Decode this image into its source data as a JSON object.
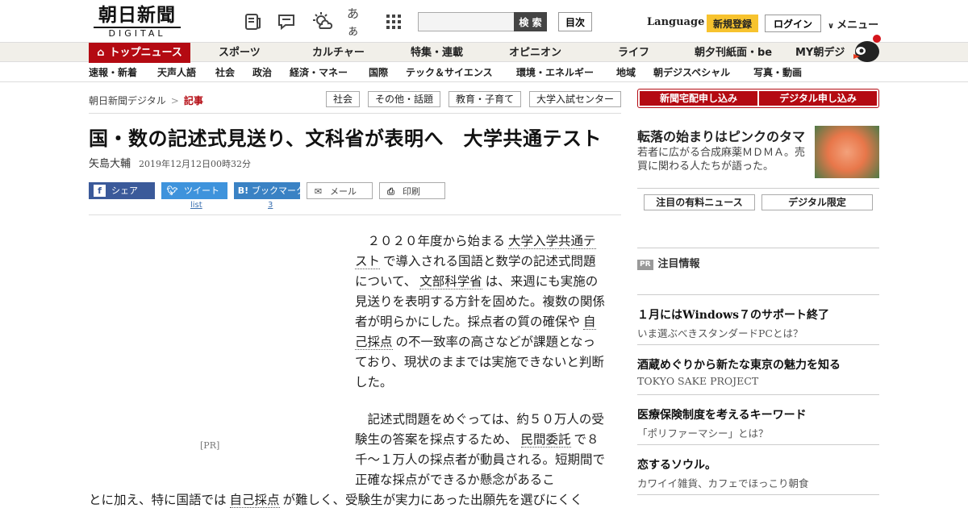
{
  "header": {
    "logo_main": "朝日新聞",
    "logo_sub": "DIGITAL",
    "text_size_icon_glyph": "あぁ",
    "search": {
      "placeholder": "",
      "button_label": "検 索"
    },
    "index_label": "目次",
    "language_label": "Language",
    "register_label": "新規登録",
    "login_label": "ログイン",
    "menu_label": "メニュー"
  },
  "main_nav": [
    "トップニュース",
    "スポーツ",
    "カルチャー",
    "特集・連載",
    "オピニオン",
    "ライフ",
    "朝夕刊紙面・be",
    "MY朝デジ"
  ],
  "sub_nav": [
    "速報・新着",
    "天声人語",
    "社会",
    "政治",
    "経済・マネー",
    "国際",
    "テック＆サイエンス",
    "環境・エネルギー",
    "地域",
    "朝デジスペシャル",
    "写真・動画"
  ],
  "breadcrumb": {
    "home": "朝日新聞デジタル",
    "separator": ">",
    "current": "記事"
  },
  "tags": [
    "社会",
    "その他・話題",
    "教育・子育て",
    "大学入試センター"
  ],
  "article": {
    "headline": "国・数の記述式見送り、文科省が表明へ　大学共通テスト",
    "author": "矢島大輔",
    "date": "2019年12月12日00時32分",
    "ad_label": "[PR]",
    "p1_a": "２０２０年度から始まる",
    "p1_kw1": "大学入学共通テスト",
    "p1_b": "で導入される国語と数学の記述式問題について、",
    "p1_kw2": "文部科学省",
    "p1_c": "は、来週にも実施の見送りを表明する方針を固めた。複数の関係者が明らかにした。採点者の質の確保や",
    "p1_kw3": "自己採点",
    "p1_d": "の不一致率の高さなどが課題となっており、現状のままでは実施できないと判断した。",
    "p2_a": "記述式問題をめぐっては、約５０万人の受験生の答案を採点するため、",
    "p2_kw1": "民間委託",
    "p2_b": "で８千～１万人の採点者が動員される。短期間で正確な採点ができるか懸念があるこ",
    "p2_c": "とに加え、特に国語では",
    "p2_kw2": "自己採点",
    "p2_d": "が難しく、受験生が実力にあった出願先を選びにくく"
  },
  "share": {
    "facebook_label": "シェア",
    "twitter_label": "ツイート",
    "twitter_count": "list",
    "hatena_label": "ブックマーク",
    "hatena_count": "3",
    "mail_label": "メール",
    "print_label": "印刷"
  },
  "sidebar": {
    "subscribe_paper": "新聞宅配申し込み",
    "subscribe_digital": "デジタル申し込み",
    "feature": {
      "title": "転落の始まりはピンクのタマ",
      "desc": "若者に広がる合成麻薬ＭＤＭＡ。売買に関わる人たちが語った。"
    },
    "tabs": [
      "注目の有料ニュース",
      "デジタル限定"
    ],
    "pr_badge": "PR",
    "pr_heading": "注目情報",
    "pr_items": [
      {
        "title": "１月にはWindows７のサポート終了",
        "desc": "いま選ぶべきスタンダードPCとは？"
      },
      {
        "title": "酒蔵めぐりから新たな東京の魅力を知る",
        "desc": "TOKYO SAKE PROJECT"
      },
      {
        "title": "医療保険制度を考えるキーワード",
        "desc": "「ポリファーマシー」とは？"
      },
      {
        "title": "恋するソウル。",
        "desc": "カワイイ雑貨、カフェでほっこり朝食"
      }
    ]
  },
  "colors": {
    "brand_red": "#b40a12",
    "register_yellow": "#f7c32e",
    "facebook": "#3b5a9a",
    "twitter": "#3e93dc",
    "hatena": "#3a82c4"
  }
}
